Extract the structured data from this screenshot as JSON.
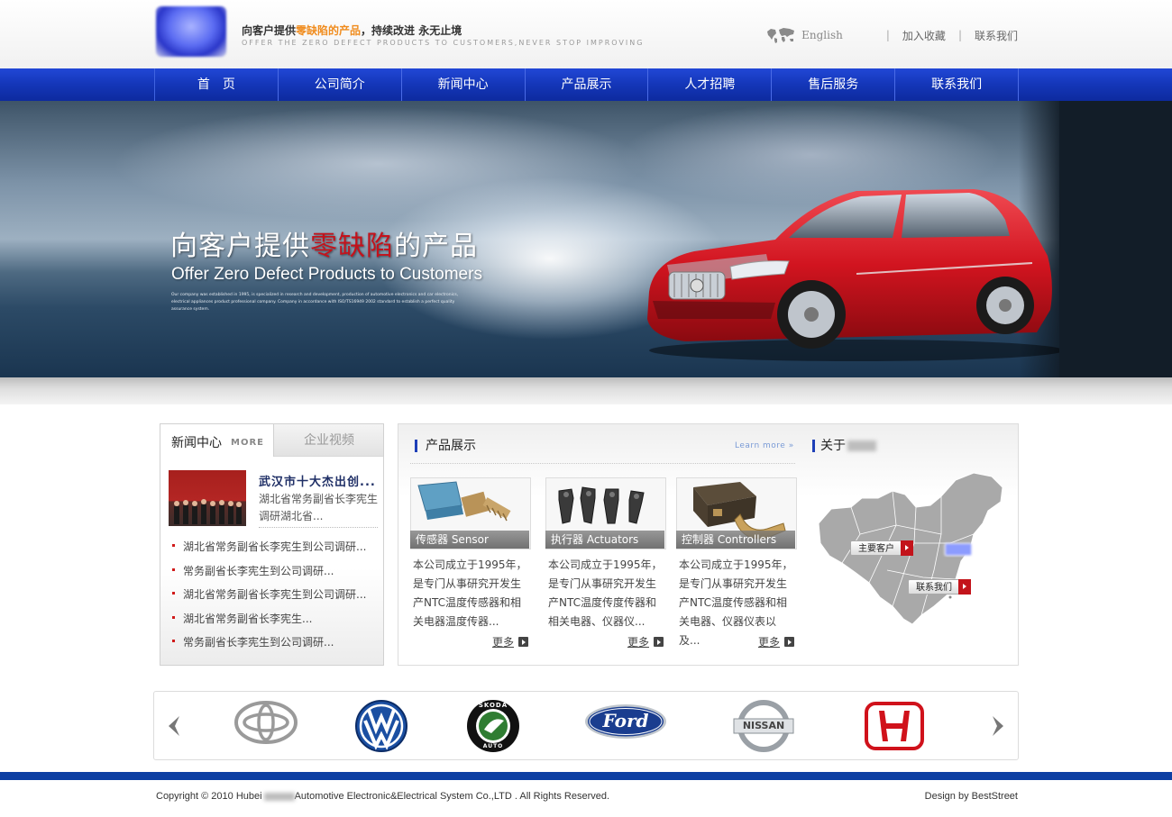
{
  "header": {
    "slogan_cn_before": "向客户提供",
    "slogan_cn_highlight": "零缺陷的产品",
    "slogan_cn_after": "，持续改进 永无止境",
    "slogan_en": "OFFER THE ZERO DEFECT PRODUCTS TO CUSTOMERS,NEVER STOP IMPROVING",
    "language": "English",
    "bookmark": "加入收藏",
    "contact": "联系我们",
    "separator": "|"
  },
  "nav": {
    "items": [
      "首　页",
      "公司简介",
      "新闻中心",
      "产品展示",
      "人才招聘",
      "售后服务",
      "联系我们"
    ]
  },
  "banner": {
    "title_before": "向客户提供",
    "title_highlight": "零缺陷",
    "title_after": "的产品",
    "subtitle": "Offer Zero Defect Products to Customers",
    "small_text": "Our company was established in 1995, is specialized in research and development, production of automotive electronics and car electronics, electrical appliances product professional company. Company in accordance with ISO/TS16949 2002 standard to establish a perfect quality assurance system."
  },
  "news": {
    "tab_active": "新闻中心",
    "tab_more": "MORE",
    "tab_other": "企业视频",
    "feature_title": "武汉市十大杰出创...",
    "feature_desc": "湖北省常务副省长李宪生调研湖北省...",
    "items": [
      "湖北省常务副省长李宪生到公司调研...",
      "常务副省长李宪生到公司调研...",
      "湖北省常务副省长李宪生到公司调研...",
      "湖北省常务副省长李宪生...",
      "常务副省长李宪生到公司调研..."
    ]
  },
  "products": {
    "heading": "产品展示",
    "learn_more": "Learn more",
    "cards": [
      {
        "label": "传感器 Sensor",
        "desc": "本公司成立于1995年，是专门从事研究开发生产NTC温度传感器和相关电器温度传器...",
        "more": "更多"
      },
      {
        "label": "执行器 Actuators",
        "desc": "本公司成立于1995年，是专门从事研究开发生产NTC温度传度传器和相关电器、仪器仪...",
        "more": "更多"
      },
      {
        "label": "控制器 Controllers",
        "desc": "本公司成立于1995年，是专门从事研究开发生产NTC温度传感器和相关电器、仪器仪表以及...",
        "more": "更多"
      }
    ]
  },
  "about": {
    "heading": "关于",
    "btn_customers": "主要客户",
    "btn_contact": "联系我们"
  },
  "brands": {
    "logos": [
      "toyota-logo",
      "volkswagen-logo",
      "skoda-logo",
      "ford-logo",
      "nissan-logo",
      "honda-logo"
    ],
    "ford_text": "Ford",
    "nissan_text": "NISSAN",
    "skoda_text": "SKODA",
    "auto_text": "AUTO"
  },
  "footer": {
    "copyright_before": "Copyright © 2010 Hubei",
    "copyright_after": "Automotive Electronic&Electrical System Co.,LTD . All Rights Reserved.",
    "design": "Design by BestStreet"
  },
  "colors": {
    "nav_blue": "#1436b8",
    "accent_red": "#c4121b",
    "highlight_orange": "#f08c1e",
    "footer_blue": "#0d3fa3"
  }
}
